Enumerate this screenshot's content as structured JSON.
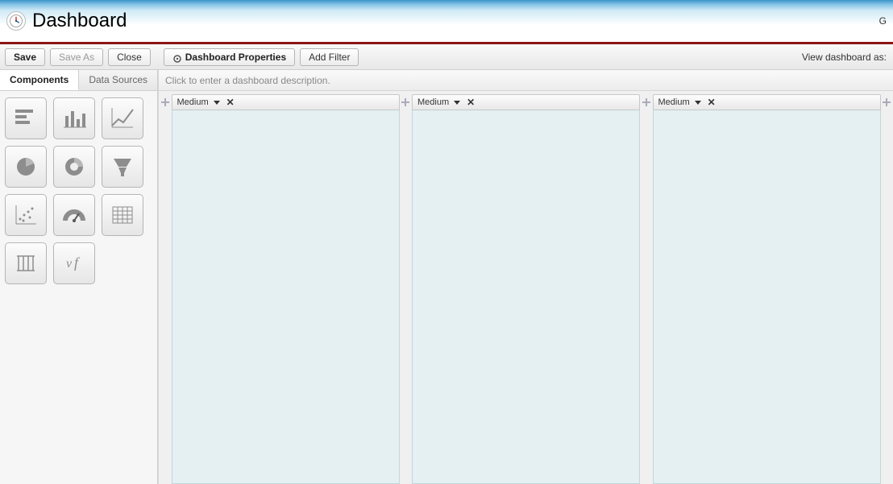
{
  "header": {
    "title": "Dashboard",
    "right_partial": "G"
  },
  "toolbar": {
    "save": "Save",
    "save_as": "Save As",
    "close": "Close",
    "dashboard_properties": "Dashboard Properties",
    "add_filter": "Add Filter",
    "view_as": "View dashboard as:"
  },
  "sidebar": {
    "tabs": {
      "components": "Components",
      "data_sources": "Data Sources"
    },
    "components": [
      {
        "name": "horizontal-bar-chart"
      },
      {
        "name": "vertical-bar-chart"
      },
      {
        "name": "line-chart"
      },
      {
        "name": "pie-chart"
      },
      {
        "name": "donut-chart"
      },
      {
        "name": "funnel-chart"
      },
      {
        "name": "scatter-chart"
      },
      {
        "name": "gauge-chart"
      },
      {
        "name": "table-component"
      },
      {
        "name": "metric-component"
      },
      {
        "name": "visualforce-component"
      }
    ]
  },
  "canvas": {
    "description_placeholder": "Click to enter a dashboard description.",
    "columns": [
      {
        "size_label": "Medium"
      },
      {
        "size_label": "Medium"
      },
      {
        "size_label": "Medium"
      }
    ]
  }
}
